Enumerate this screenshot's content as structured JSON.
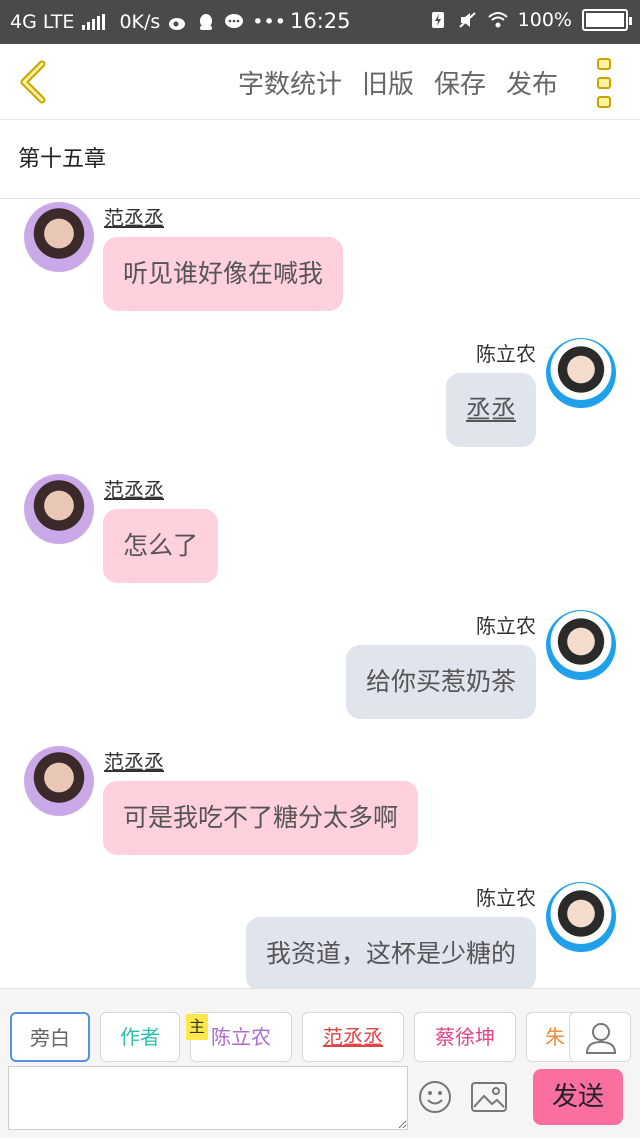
{
  "status_bar": {
    "network": "4G LTE",
    "speed": "0K/s",
    "time": "16:25",
    "battery": "100%"
  },
  "toolbar": {
    "word_count": "字数统计",
    "old_version": "旧版",
    "save": "保存",
    "publish": "发布"
  },
  "chapter_title": "第十五章",
  "messages": [
    {
      "sender": "范丞丞",
      "text": "听见谁好像在喊我",
      "side": "left"
    },
    {
      "sender": "陈立农",
      "text": "丞丞",
      "side": "right"
    },
    {
      "sender": "范丞丞",
      "text": "怎么了",
      "side": "left"
    },
    {
      "sender": "陈立农",
      "text": "给你买惹奶茶",
      "side": "right"
    },
    {
      "sender": "范丞丞",
      "text": "可是我吃不了糖分太多啊",
      "side": "left"
    },
    {
      "sender": "陈立农",
      "text": "我资道，这杯是少糖的",
      "side": "right"
    }
  ],
  "characters": {
    "narration": "旁白",
    "author": "作者",
    "host_tag": "主",
    "chen": "陈立农",
    "fan": "范丞丞",
    "cai": "蔡徐坤",
    "zhu": "朱"
  },
  "input": {
    "value": "",
    "send_label": "发送"
  },
  "colors": {
    "pink_bubble": "#ffd1dc",
    "blue_bubble": "#e0e5ed",
    "send_button": "#fb6ea0",
    "author_chip": "#2bbfb0",
    "chen_chip": "#b06ad6",
    "fan_chip": "#e04545",
    "cai_chip": "#e0458a",
    "zhu_chip": "#f08a3c"
  }
}
